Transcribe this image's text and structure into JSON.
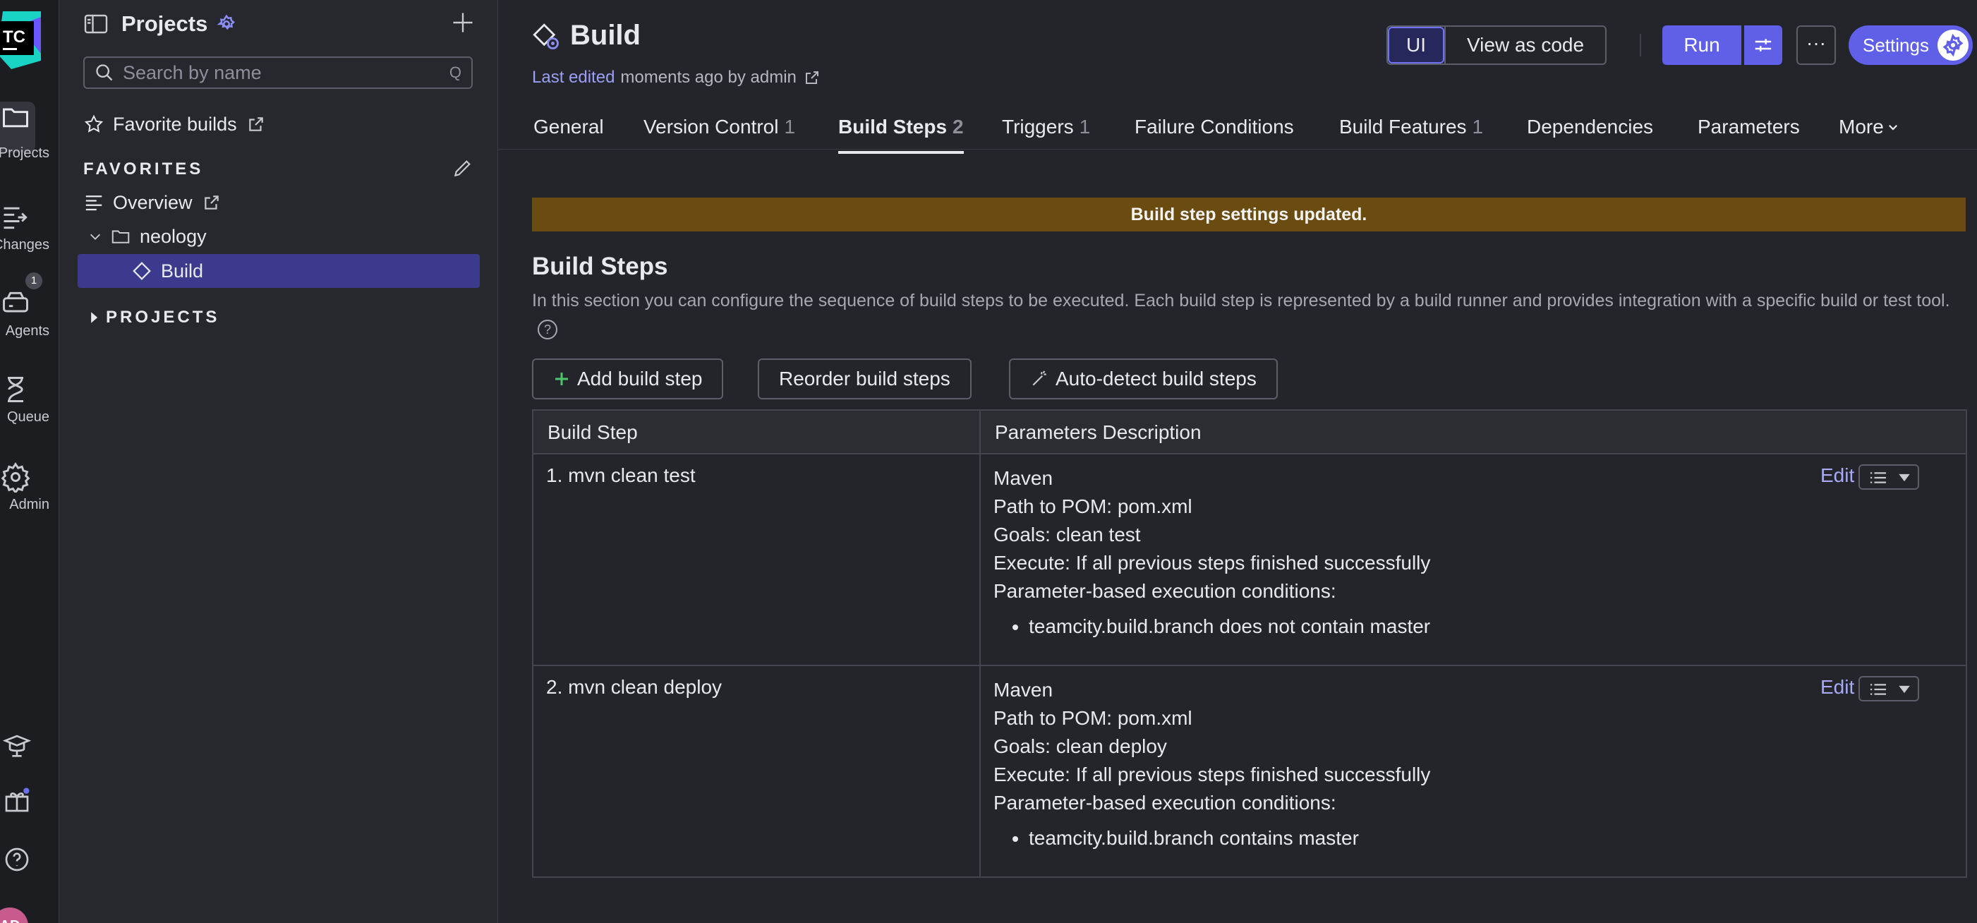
{
  "rail": {
    "logo_text": "TC",
    "items": [
      {
        "label": "Projects",
        "icon": "folder-icon"
      },
      {
        "label": "Changes",
        "icon": "changes-icon"
      },
      {
        "label": "Agents",
        "icon": "agents-icon",
        "badge": "1"
      },
      {
        "label": "Queue",
        "icon": "hourglass-icon"
      },
      {
        "label": "Admin",
        "icon": "gear-icon"
      }
    ],
    "avatar": "AD"
  },
  "sidebar": {
    "title": "Projects",
    "search_placeholder": "Search by name",
    "search_shortcut": "Q",
    "favorite_builds": "Favorite builds",
    "favorites_heading": "FAVORITES",
    "tree": [
      {
        "label": "Overview"
      },
      {
        "label": "neology"
      },
      {
        "label": "Build"
      }
    ],
    "projects_heading": "PROJECTS"
  },
  "header": {
    "title": "Build",
    "last_edited_label": "Last edited",
    "last_edited_text": "moments ago by admin",
    "view_ui": "UI",
    "view_code": "View as code",
    "run": "Run",
    "more": "···",
    "settings": "Settings"
  },
  "tabs": [
    {
      "label": "General",
      "count": ""
    },
    {
      "label": "Version Control",
      "count": "1"
    },
    {
      "label": "Build Steps",
      "count": "2"
    },
    {
      "label": "Triggers",
      "count": "1"
    },
    {
      "label": "Failure Conditions",
      "count": ""
    },
    {
      "label": "Build Features",
      "count": "1"
    },
    {
      "label": "Dependencies",
      "count": ""
    },
    {
      "label": "Parameters",
      "count": ""
    },
    {
      "label": "More",
      "count": ""
    }
  ],
  "banner": "Build step settings updated.",
  "section": {
    "title": "Build Steps",
    "description": "In this section you can configure the sequence of build steps to be executed. Each build step is represented by a build runner and provides integration with a specific build or test tool.",
    "help": "?"
  },
  "actions": {
    "add": "Add build step",
    "reorder": "Reorder build steps",
    "autodetect": "Auto-detect build steps"
  },
  "table": {
    "col1": "Build Step",
    "col2": "Parameters Description",
    "edit_label": "Edit",
    "rows": [
      {
        "step": "1. mvn clean test",
        "runner": "Maven",
        "pom": "Path to POM: pom.xml",
        "goals": "Goals: clean test",
        "execute": "Execute: If all previous steps finished successfully",
        "conditions_label": "Parameter-based execution conditions:",
        "condition": "teamcity.build.branch does not contain master"
      },
      {
        "step": "2. mvn clean deploy",
        "runner": "Maven",
        "pom": "Path to POM: pom.xml",
        "goals": "Goals: clean deploy",
        "execute": "Execute: If all previous steps finished successfully",
        "conditions_label": "Parameter-based execution conditions:",
        "condition": "teamcity.build.branch contains master"
      }
    ]
  },
  "colors": {
    "accent": "#5f5fe8",
    "banner": "#6a4b10",
    "selected": "#3b3a8c",
    "link": "#9b9ff5"
  }
}
